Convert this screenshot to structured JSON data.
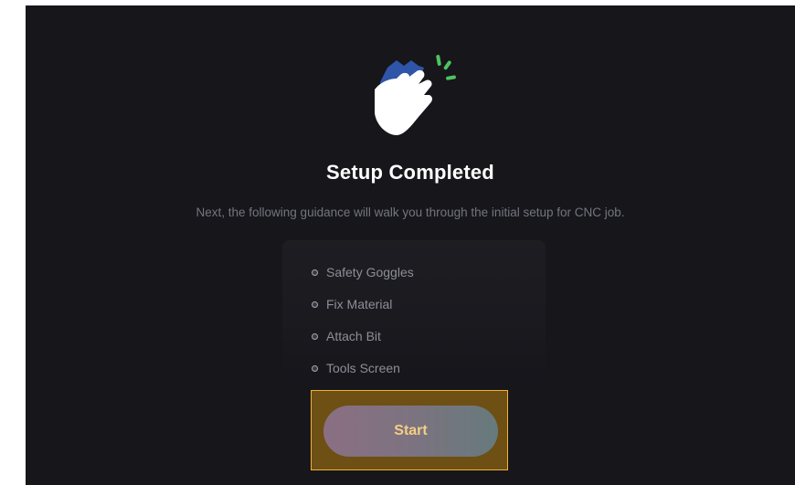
{
  "header": {
    "title": "Setup Completed",
    "subtitle": "Next, the following guidance will walk you through the initial setup for CNC job."
  },
  "illustration": {
    "icon": "clapping-hands-icon",
    "colors": {
      "hand_back": "#2f55a8",
      "hand_front": "#ffffff",
      "sparkle": "#4fc35f"
    }
  },
  "checklist": {
    "items": [
      {
        "label": "Safety Goggles"
      },
      {
        "label": "Fix Material"
      },
      {
        "label": "Attach Bit"
      },
      {
        "label": "Tools Screen"
      }
    ]
  },
  "actions": {
    "start_label": "Start"
  },
  "colors": {
    "background": "#16161b",
    "highlight_border": "#f0b23a",
    "button_text": "#f4cf83"
  }
}
